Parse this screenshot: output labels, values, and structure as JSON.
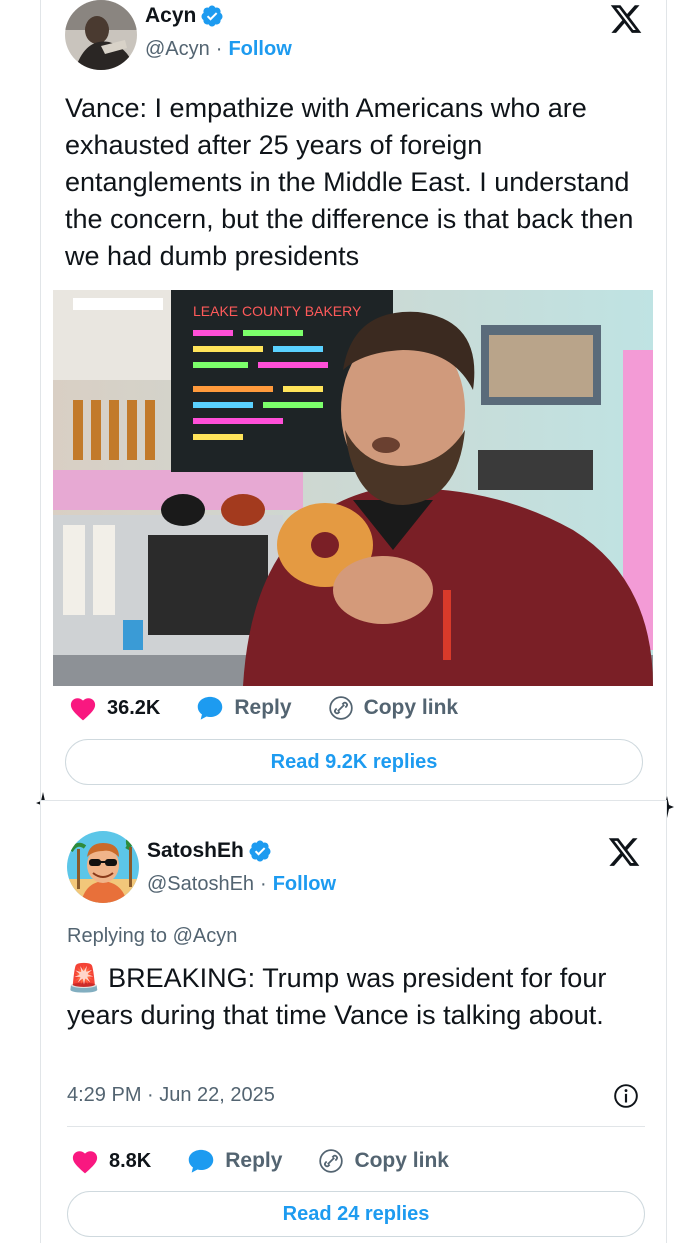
{
  "tweet1": {
    "name": "Acyn",
    "handle": "@Acyn",
    "sep": "·",
    "follow": "Follow",
    "text": "Vance: I empathize with Americans who are exhausted after 25 years of foreign entanglements in the Middle East. I understand the concern, but the difference is that back then we had dumb presidents",
    "photo_sign": "LEAKE COUNTY BAKERY",
    "likes": "36.2K",
    "reply": "Reply",
    "copy_link": "Copy link",
    "read_replies": "Read 9.2K replies"
  },
  "tweet2": {
    "name": "SatoshEh",
    "handle": "@SatoshEh",
    "sep": "·",
    "follow": "Follow",
    "replying_to": "Replying to @Acyn",
    "emoji": "🚨",
    "text": "BREAKING: Trump was president for four years during that time Vance is talking about.",
    "timestamp": "4:29 PM · Jun 22, 2025",
    "likes": "8.8K",
    "reply": "Reply",
    "copy_link": "Copy link",
    "read_replies": "Read 24 replies"
  },
  "colors": {
    "accent": "#1d9bf0",
    "like": "#f91880",
    "text": "#0f1419",
    "muted": "#536471"
  }
}
